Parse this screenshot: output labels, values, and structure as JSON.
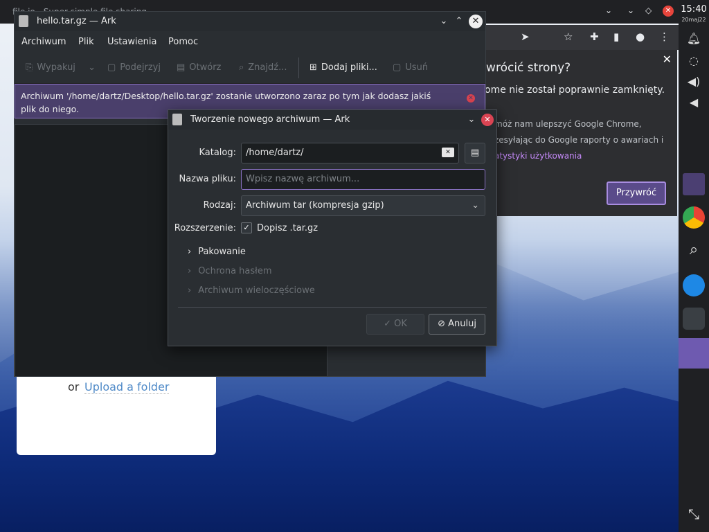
{
  "browser": {
    "tab_title": "file.io - Super simple file sharing",
    "restore_title": "ywrócić strony?",
    "restore_msg": "ome nie został poprawnie zamknięty.",
    "restore_small1": "móż nam ulepszyć Google Chrome,",
    "restore_small2": "zesyłając do Google raporty o awariach i",
    "restore_link": "atystyki użytkowania",
    "restore_button": "Przywróć"
  },
  "page": {
    "or_text": "or",
    "upload_folder": "Upload a folder"
  },
  "panel": {
    "time": "15:40",
    "date": "20maj22"
  },
  "ark": {
    "title": "hello.tar.gz — Ark",
    "menu": [
      "Archiwum",
      "Plik",
      "Ustawienia",
      "Pomoc"
    ],
    "toolbar": {
      "extract": "Wypakuj",
      "preview": "Podejrzyj",
      "open": "Otwórz",
      "find": "Znajdź...",
      "add_files": "Dodaj pliki...",
      "remove": "Usuń"
    },
    "info_line1": "Archiwum '/home/dartz/Desktop/hello.tar.gz' zostanie utworzono zaraz po tym jak dodasz jakiś",
    "info_line2": "plik do niego."
  },
  "dialog": {
    "title": "Tworzenie nowego archiwum — Ark",
    "folder_label": "Katalog:",
    "folder_value": "/home/dartz/",
    "filename_label": "Nazwa pliku:",
    "filename_placeholder": "Wpisz nazwę archiwum...",
    "type_label": "Rodzaj:",
    "type_value": "Archiwum tar (kompresja gzip)",
    "extension_label": "Rozszerzenie:",
    "extension_check_label": "Dopisz .tar.gz",
    "sections": {
      "packing": "Pakowanie",
      "password": "Ochrona hasłem",
      "multivolume": "Archiwum wieloczęściowe"
    },
    "ok_label": "OK",
    "cancel_label": "Anuluj"
  }
}
